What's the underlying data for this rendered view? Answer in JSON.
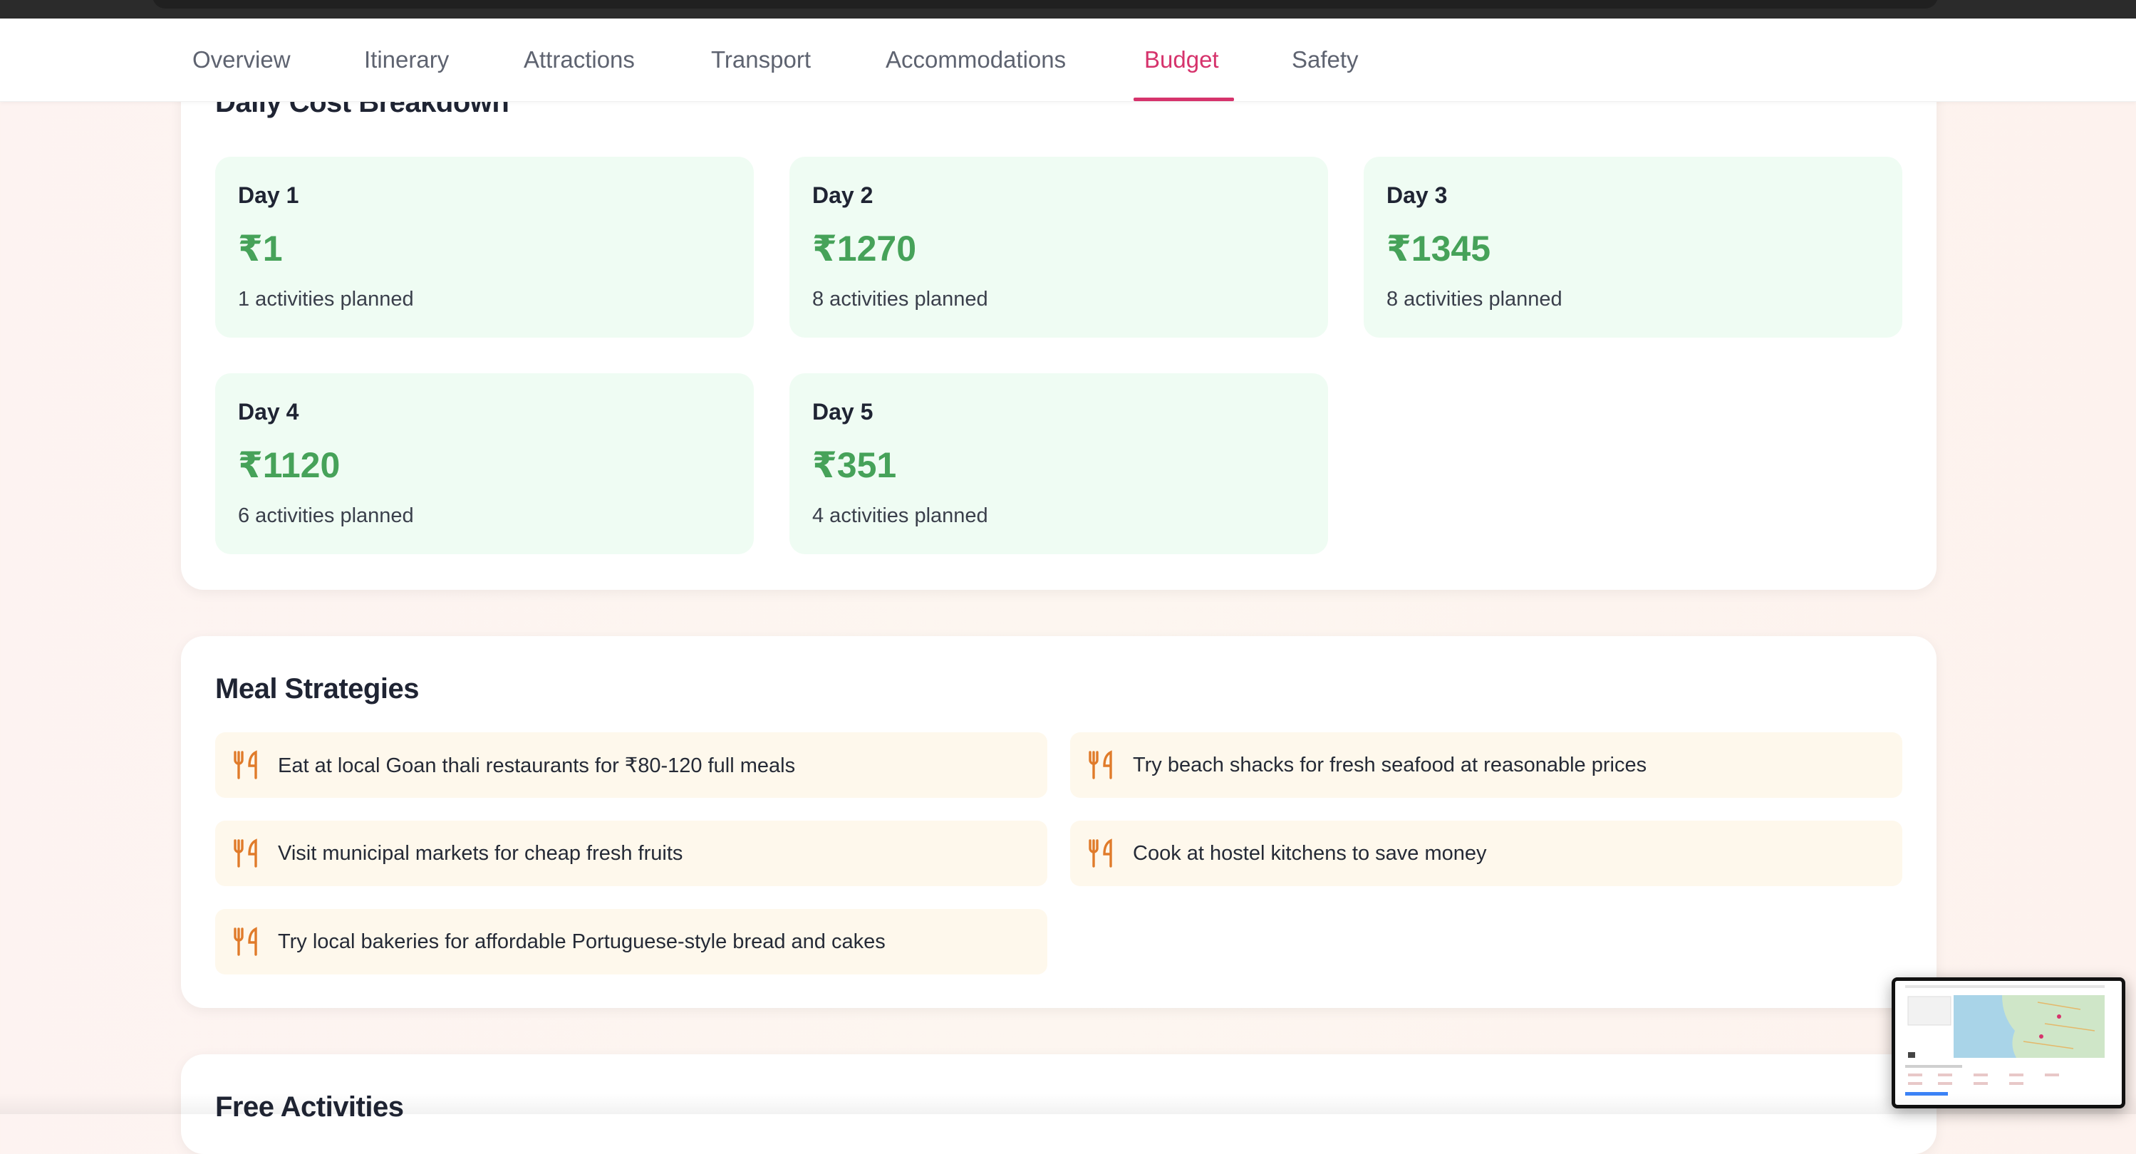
{
  "nav": {
    "tabs": [
      {
        "label": "Overview"
      },
      {
        "label": "Itinerary"
      },
      {
        "label": "Attractions"
      },
      {
        "label": "Transport"
      },
      {
        "label": "Accommodations"
      },
      {
        "label": "Budget"
      },
      {
        "label": "Safety"
      }
    ],
    "active_tab": "Budget"
  },
  "daily_breakdown": {
    "title": "Daily Cost Breakdown",
    "days": [
      {
        "label": "Day 1",
        "amount": "₹1",
        "activities": "1 activities planned"
      },
      {
        "label": "Day 2",
        "amount": "₹1270",
        "activities": "8 activities planned"
      },
      {
        "label": "Day 3",
        "amount": "₹1345",
        "activities": "8 activities planned"
      },
      {
        "label": "Day 4",
        "amount": "₹1120",
        "activities": "6 activities planned"
      },
      {
        "label": "Day 5",
        "amount": "₹351",
        "activities": "4 activities planned"
      }
    ]
  },
  "meal_strategies": {
    "title": "Meal Strategies",
    "icon": "utensils-icon",
    "items": [
      {
        "text": "Eat at local Goan thali restaurants for ₹80-120 full meals"
      },
      {
        "text": "Try beach shacks for fresh seafood at reasonable prices"
      },
      {
        "text": "Visit municipal markets for cheap fresh fruits"
      },
      {
        "text": "Cook at hostel kitchens to save money"
      },
      {
        "text": "Try local bakeries for affordable Portuguese-style bread and cakes"
      }
    ]
  },
  "free_activities": {
    "title": "Free Activities"
  },
  "colors": {
    "accent": "#d6336c",
    "amount_green": "#46a259",
    "day_card_bg": "#effcf3",
    "meal_item_bg": "#fef8ec",
    "meal_icon": "#e07b2a"
  }
}
